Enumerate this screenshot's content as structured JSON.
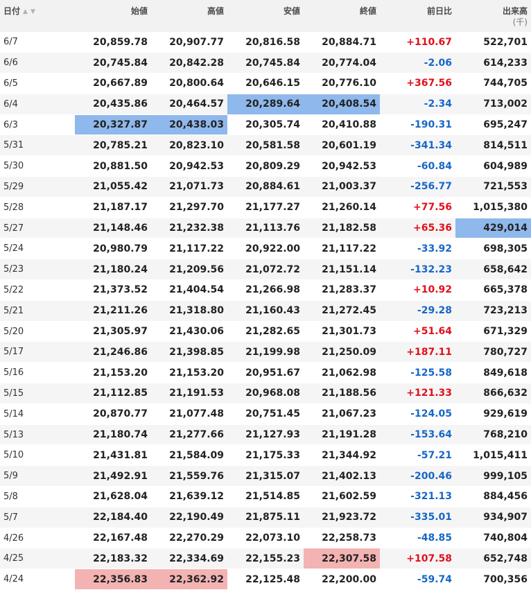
{
  "headers": {
    "date": "日付",
    "open": "始値",
    "high": "高値",
    "low": "安値",
    "close": "終値",
    "change": "前日比",
    "volume": "出来高",
    "volume_unit": "(千)"
  },
  "icons": {
    "sort_up": "▲",
    "sort_down": "▼"
  },
  "colors": {
    "positive": "#e0101b",
    "negative": "#1667c7",
    "highlight_low": "#8fb8ec",
    "highlight_high": "#f4b3b3"
  },
  "rows": [
    {
      "date": "6/7",
      "open": "20,859.78",
      "high": "20,907.77",
      "low": "20,816.58",
      "close": "20,884.71",
      "change": "+110.67",
      "volume": "522,701"
    },
    {
      "date": "6/6",
      "open": "20,745.84",
      "high": "20,842.28",
      "low": "20,745.84",
      "close": "20,774.04",
      "change": "-2.06",
      "volume": "614,233"
    },
    {
      "date": "6/5",
      "open": "20,667.89",
      "high": "20,800.64",
      "low": "20,646.15",
      "close": "20,776.10",
      "change": "+367.56",
      "volume": "744,705"
    },
    {
      "date": "6/4",
      "open": "20,435.86",
      "high": "20,464.57",
      "low": "20,289.64",
      "close": "20,408.54",
      "change": "-2.34",
      "volume": "713,002"
    },
    {
      "date": "6/3",
      "open": "20,327.87",
      "high": "20,438.03",
      "low": "20,305.74",
      "close": "20,410.88",
      "change": "-190.31",
      "volume": "695,247"
    },
    {
      "date": "5/31",
      "open": "20,785.21",
      "high": "20,823.10",
      "low": "20,581.58",
      "close": "20,601.19",
      "change": "-341.34",
      "volume": "814,511"
    },
    {
      "date": "5/30",
      "open": "20,881.50",
      "high": "20,942.53",
      "low": "20,809.29",
      "close": "20,942.53",
      "change": "-60.84",
      "volume": "604,989"
    },
    {
      "date": "5/29",
      "open": "21,055.42",
      "high": "21,071.73",
      "low": "20,884.61",
      "close": "21,003.37",
      "change": "-256.77",
      "volume": "721,553"
    },
    {
      "date": "5/28",
      "open": "21,187.17",
      "high": "21,297.70",
      "low": "21,177.27",
      "close": "21,260.14",
      "change": "+77.56",
      "volume": "1,015,380"
    },
    {
      "date": "5/27",
      "open": "21,148.46",
      "high": "21,232.38",
      "low": "21,113.76",
      "close": "21,182.58",
      "change": "+65.36",
      "volume": "429,014"
    },
    {
      "date": "5/24",
      "open": "20,980.79",
      "high": "21,117.22",
      "low": "20,922.00",
      "close": "21,117.22",
      "change": "-33.92",
      "volume": "698,305"
    },
    {
      "date": "5/23",
      "open": "21,180.24",
      "high": "21,209.56",
      "low": "21,072.72",
      "close": "21,151.14",
      "change": "-132.23",
      "volume": "658,642"
    },
    {
      "date": "5/22",
      "open": "21,373.52",
      "high": "21,404.54",
      "low": "21,266.98",
      "close": "21,283.37",
      "change": "+10.92",
      "volume": "665,378"
    },
    {
      "date": "5/21",
      "open": "21,211.26",
      "high": "21,318.80",
      "low": "21,160.43",
      "close": "21,272.45",
      "change": "-29.28",
      "volume": "723,213"
    },
    {
      "date": "5/20",
      "open": "21,305.97",
      "high": "21,430.06",
      "low": "21,282.65",
      "close": "21,301.73",
      "change": "+51.64",
      "volume": "671,329"
    },
    {
      "date": "5/17",
      "open": "21,246.86",
      "high": "21,398.85",
      "low": "21,199.98",
      "close": "21,250.09",
      "change": "+187.11",
      "volume": "780,727"
    },
    {
      "date": "5/16",
      "open": "21,153.20",
      "high": "21,153.20",
      "low": "20,951.67",
      "close": "21,062.98",
      "change": "-125.58",
      "volume": "849,618"
    },
    {
      "date": "5/15",
      "open": "21,112.85",
      "high": "21,191.53",
      "low": "20,968.08",
      "close": "21,188.56",
      "change": "+121.33",
      "volume": "866,632"
    },
    {
      "date": "5/14",
      "open": "20,870.77",
      "high": "21,077.48",
      "low": "20,751.45",
      "close": "21,067.23",
      "change": "-124.05",
      "volume": "929,619"
    },
    {
      "date": "5/13",
      "open": "21,180.74",
      "high": "21,277.66",
      "low": "21,127.93",
      "close": "21,191.28",
      "change": "-153.64",
      "volume": "768,210"
    },
    {
      "date": "5/10",
      "open": "21,431.81",
      "high": "21,584.09",
      "low": "21,175.33",
      "close": "21,344.92",
      "change": "-57.21",
      "volume": "1,015,411"
    },
    {
      "date": "5/9",
      "open": "21,492.91",
      "high": "21,559.76",
      "low": "21,315.07",
      "close": "21,402.13",
      "change": "-200.46",
      "volume": "999,105"
    },
    {
      "date": "5/8",
      "open": "21,628.04",
      "high": "21,639.12",
      "low": "21,514.85",
      "close": "21,602.59",
      "change": "-321.13",
      "volume": "884,456"
    },
    {
      "date": "5/7",
      "open": "22,184.40",
      "high": "22,190.49",
      "low": "21,875.11",
      "close": "21,923.72",
      "change": "-335.01",
      "volume": "934,907"
    },
    {
      "date": "4/26",
      "open": "22,167.48",
      "high": "22,270.29",
      "low": "22,073.10",
      "close": "22,258.73",
      "change": "-48.85",
      "volume": "740,804"
    },
    {
      "date": "4/25",
      "open": "22,183.32",
      "high": "22,334.69",
      "low": "22,155.23",
      "close": "22,307.58",
      "change": "+107.58",
      "volume": "652,748"
    },
    {
      "date": "4/24",
      "open": "22,356.83",
      "high": "22,362.92",
      "low": "22,125.48",
      "close": "22,200.00",
      "change": "-59.74",
      "volume": "700,356"
    }
  ],
  "highlights": {
    "blue": [
      [
        3,
        "low"
      ],
      [
        3,
        "close"
      ],
      [
        4,
        "open"
      ],
      [
        4,
        "high"
      ],
      [
        9,
        "volume"
      ]
    ],
    "red": [
      [
        25,
        "close"
      ],
      [
        26,
        "open"
      ],
      [
        26,
        "high"
      ]
    ]
  }
}
